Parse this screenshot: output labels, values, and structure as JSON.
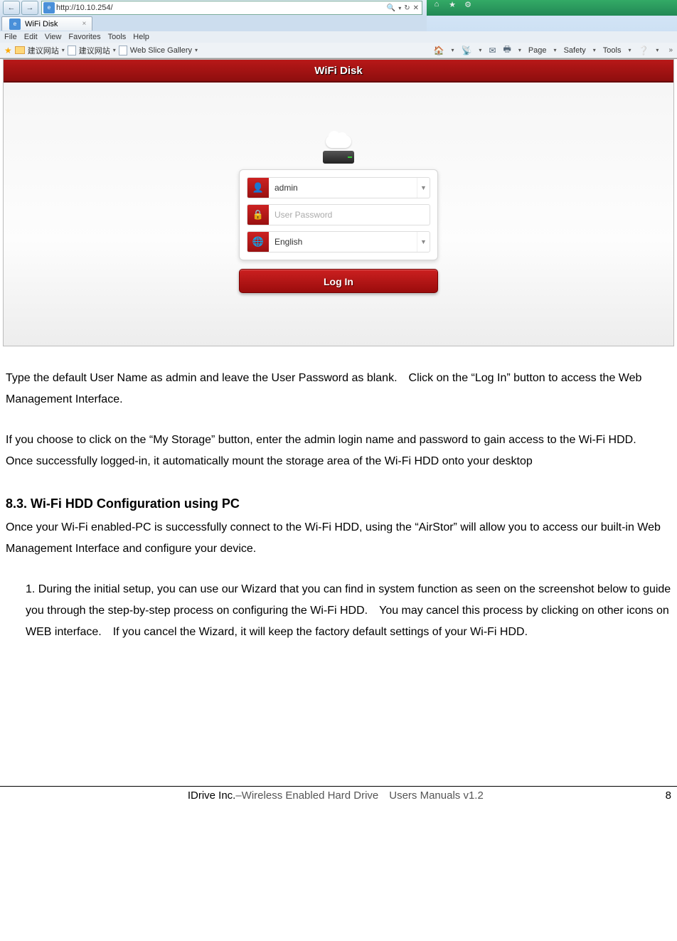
{
  "browser": {
    "url": "http://10.10.254/",
    "menu": [
      "File",
      "Edit",
      "View",
      "Favorites",
      "Tools",
      "Help"
    ],
    "fav_items": [
      "建议网站",
      "建议网站",
      "Web Slice Gallery"
    ],
    "tab_title": "WiFi Disk",
    "cmdbar": [
      "Page",
      "Safety",
      "Tools"
    ],
    "search_hint": "🔍"
  },
  "shot": {
    "header": "WiFi Disk",
    "username": "admin",
    "password_placeholder": "User Password",
    "language": "English",
    "login_btn": "Log In"
  },
  "doc": {
    "p1": "Type the default User Name as admin and leave the User Password as blank. Click on the “Log In” button to access the Web Management Interface.",
    "p2": "If you choose to click on the “My Storage” button, enter the admin login name and password to gain access to the Wi-Fi HDD. Once successfully logged-in, it automatically mount the storage area of the Wi-Fi HDD onto your desktop",
    "h3": "8.3. Wi-Fi HDD Configuration using PC",
    "p3": "Once your Wi-Fi enabled-PC is successfully connect to the Wi-Fi HDD, using the “AirStor” will allow you to access our built-in Web Management Interface and configure your device.",
    "p4": "1. During the initial setup, you can use our Wizard that you can find in system function as seen on the screenshot below to guide you through the step-by-step process on configuring the Wi-Fi HDD. You may cancel this process by clicking on other icons on WEB interface. If you cancel the Wizard, it will keep the factory default settings of your Wi-Fi HDD."
  },
  "footer": {
    "left_bold": "IDrive Inc.",
    "left_rest": "–Wireless Enabled Hard Drive Users Manuals v1.2",
    "page": "8"
  }
}
